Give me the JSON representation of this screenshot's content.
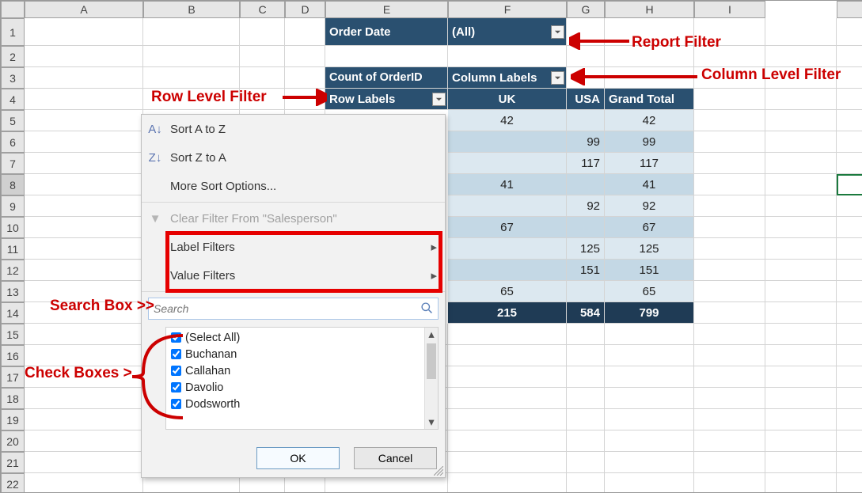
{
  "grid": {
    "col_letters": [
      "A",
      "B",
      "C",
      "D",
      "E",
      "F",
      "G",
      "H",
      "I"
    ],
    "row_numbers": [
      1,
      2,
      3,
      4,
      5,
      6,
      7,
      8,
      9,
      10,
      11,
      12,
      13,
      14,
      15,
      16,
      17,
      18,
      19,
      20,
      21,
      22
    ]
  },
  "pivot": {
    "filter_field": "Order Date",
    "filter_value": "(All)",
    "values_field": "Count of OrderID",
    "col_field_label": "Column Labels",
    "row_field_label": "Row Labels",
    "columns": [
      "UK",
      "USA"
    ],
    "grand_total_col": "Grand Total",
    "grand_total_row": "Grand Total",
    "rows": [
      {
        "uk": 42,
        "usa": null,
        "total": 42
      },
      {
        "uk": null,
        "usa": 99,
        "total": 99
      },
      {
        "uk": null,
        "usa": 117,
        "total": 117
      },
      {
        "uk": 41,
        "usa": null,
        "total": 41
      },
      {
        "uk": null,
        "usa": 92,
        "total": 92
      },
      {
        "uk": 67,
        "usa": null,
        "total": 67
      },
      {
        "uk": null,
        "usa": 125,
        "total": 125
      },
      {
        "uk": null,
        "usa": 151,
        "total": 151
      },
      {
        "uk": 65,
        "usa": null,
        "total": 65
      }
    ],
    "grand": {
      "uk": 215,
      "usa": 584,
      "total": 799
    }
  },
  "menu": {
    "sort_az": "Sort A to Z",
    "sort_za": "Sort Z to A",
    "more_sort": "More Sort Options...",
    "clear": "Clear Filter From \"Salesperson\"",
    "label_filters": "Label Filters",
    "value_filters": "Value Filters",
    "search_placeholder": "Search",
    "items": [
      "(Select All)",
      "Buchanan",
      "Callahan",
      "Davolio",
      "Dodsworth"
    ],
    "ok": "OK",
    "cancel": "Cancel"
  },
  "annotations": {
    "report_filter": "Report Filter",
    "col_level_filter": "Column Level Filter",
    "row_level_filter": "Row Level Filter",
    "search_box": "Search Box >>",
    "check_boxes": "Check Boxes >"
  }
}
